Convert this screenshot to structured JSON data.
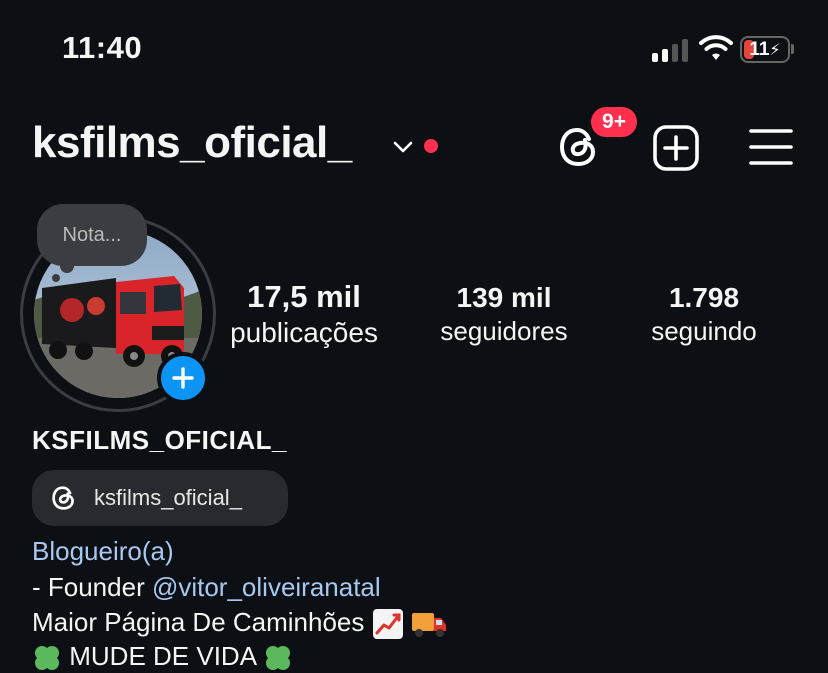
{
  "status_bar": {
    "time": "11:40",
    "battery": "11"
  },
  "header": {
    "username": "ksfilms_oficial_",
    "notification_count": "9+"
  },
  "profile": {
    "note": "Nota...",
    "stats": [
      {
        "value": "17,5 mil",
        "label": "publicações"
      },
      {
        "value": "139 mil",
        "label": "seguidores"
      },
      {
        "value": "1.798",
        "label": "seguindo"
      }
    ],
    "full_name": "KSFILMS_OFICIAL_",
    "threads_handle": "ksfilms_oficial_",
    "category": "Blogueiro(a)",
    "bio": {
      "line1_prefix": "- Founder ",
      "line1_mention": "@vitor_oliveiranatal",
      "line2": "Maior Página De Caminhões",
      "line3": "MUDE DE VIDA"
    }
  },
  "colors": {
    "background": "#0c0f14",
    "accent_red": "#ff2f4e",
    "accent_blue": "#0d95f6",
    "link": "#a9c8f0"
  },
  "icons": [
    "signal-icon",
    "wifi-icon",
    "battery-icon",
    "chevron-down-icon",
    "threads-icon",
    "create-post-icon",
    "menu-icon",
    "plus-icon",
    "chart-emoji-icon",
    "truck-emoji-icon",
    "clover-emoji-icon"
  ]
}
